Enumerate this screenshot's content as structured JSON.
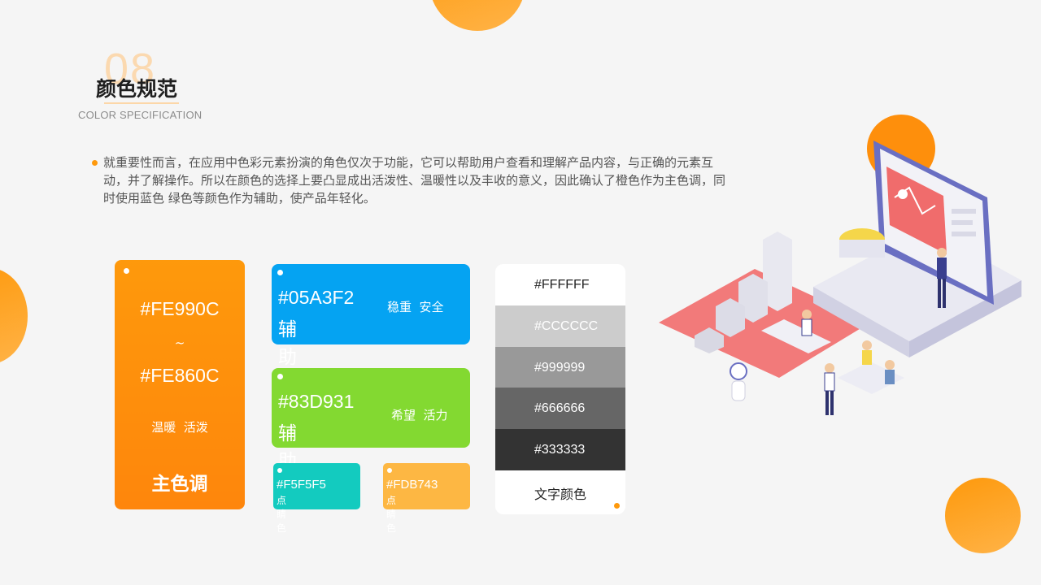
{
  "header": {
    "section_number": "08",
    "title": "颜色规范",
    "subtitle": "COLOR SPECIFICATION"
  },
  "description": "就重要性而言，在应用中色彩元素扮演的角色仅次于功能，它可以帮助用户查看和理解产品内容，与正确的元素互动，并了解操作。所以在颜色的选择上要凸显成出活泼性、温暖性以及丰收的意义，因此确认了橙色作为主色调，同时使用蓝色 绿色等颜色作为辅助，使产品年轻化。",
  "primary": {
    "code_from": "#FE990C",
    "tilde": "~",
    "code_to": "#FE860C",
    "keywords": "温暖  活泼",
    "role": "主色调",
    "color_from": "#FE990C",
    "color_to": "#FE860C"
  },
  "secondary": [
    {
      "code": "#05A3F2",
      "role": "辅助色",
      "keywords": "稳重  安全",
      "color": "#05A3F2"
    },
    {
      "code": "#83D931",
      "role": "辅助色",
      "keywords": "希望  活力",
      "color": "#83D931"
    }
  ],
  "accents": [
    {
      "code": "#F5F5F5",
      "role": "点睛色",
      "color": "#13CBBF"
    },
    {
      "code": "#FDB743",
      "role": "点睛色",
      "color": "#FDB743"
    }
  ],
  "text_palette": {
    "swatches": [
      {
        "code": "#FFFFFF",
        "bg": "#FFFFFF",
        "fg": "#222222"
      },
      {
        "code": "#CCCCCC",
        "bg": "#CCCCCC",
        "fg": "#FFFFFF"
      },
      {
        "code": "#999999",
        "bg": "#999999",
        "fg": "#FFFFFF"
      },
      {
        "code": "#666666",
        "bg": "#666666",
        "fg": "#FFFFFF"
      },
      {
        "code": "#333333",
        "bg": "#333333",
        "fg": "#FFFFFF"
      }
    ],
    "label": "文字颜色"
  },
  "colors": {
    "accent": "#FE990C",
    "background": "#F5F5F5"
  },
  "illustration": {
    "icon": "isometric-analytics-illustration"
  }
}
